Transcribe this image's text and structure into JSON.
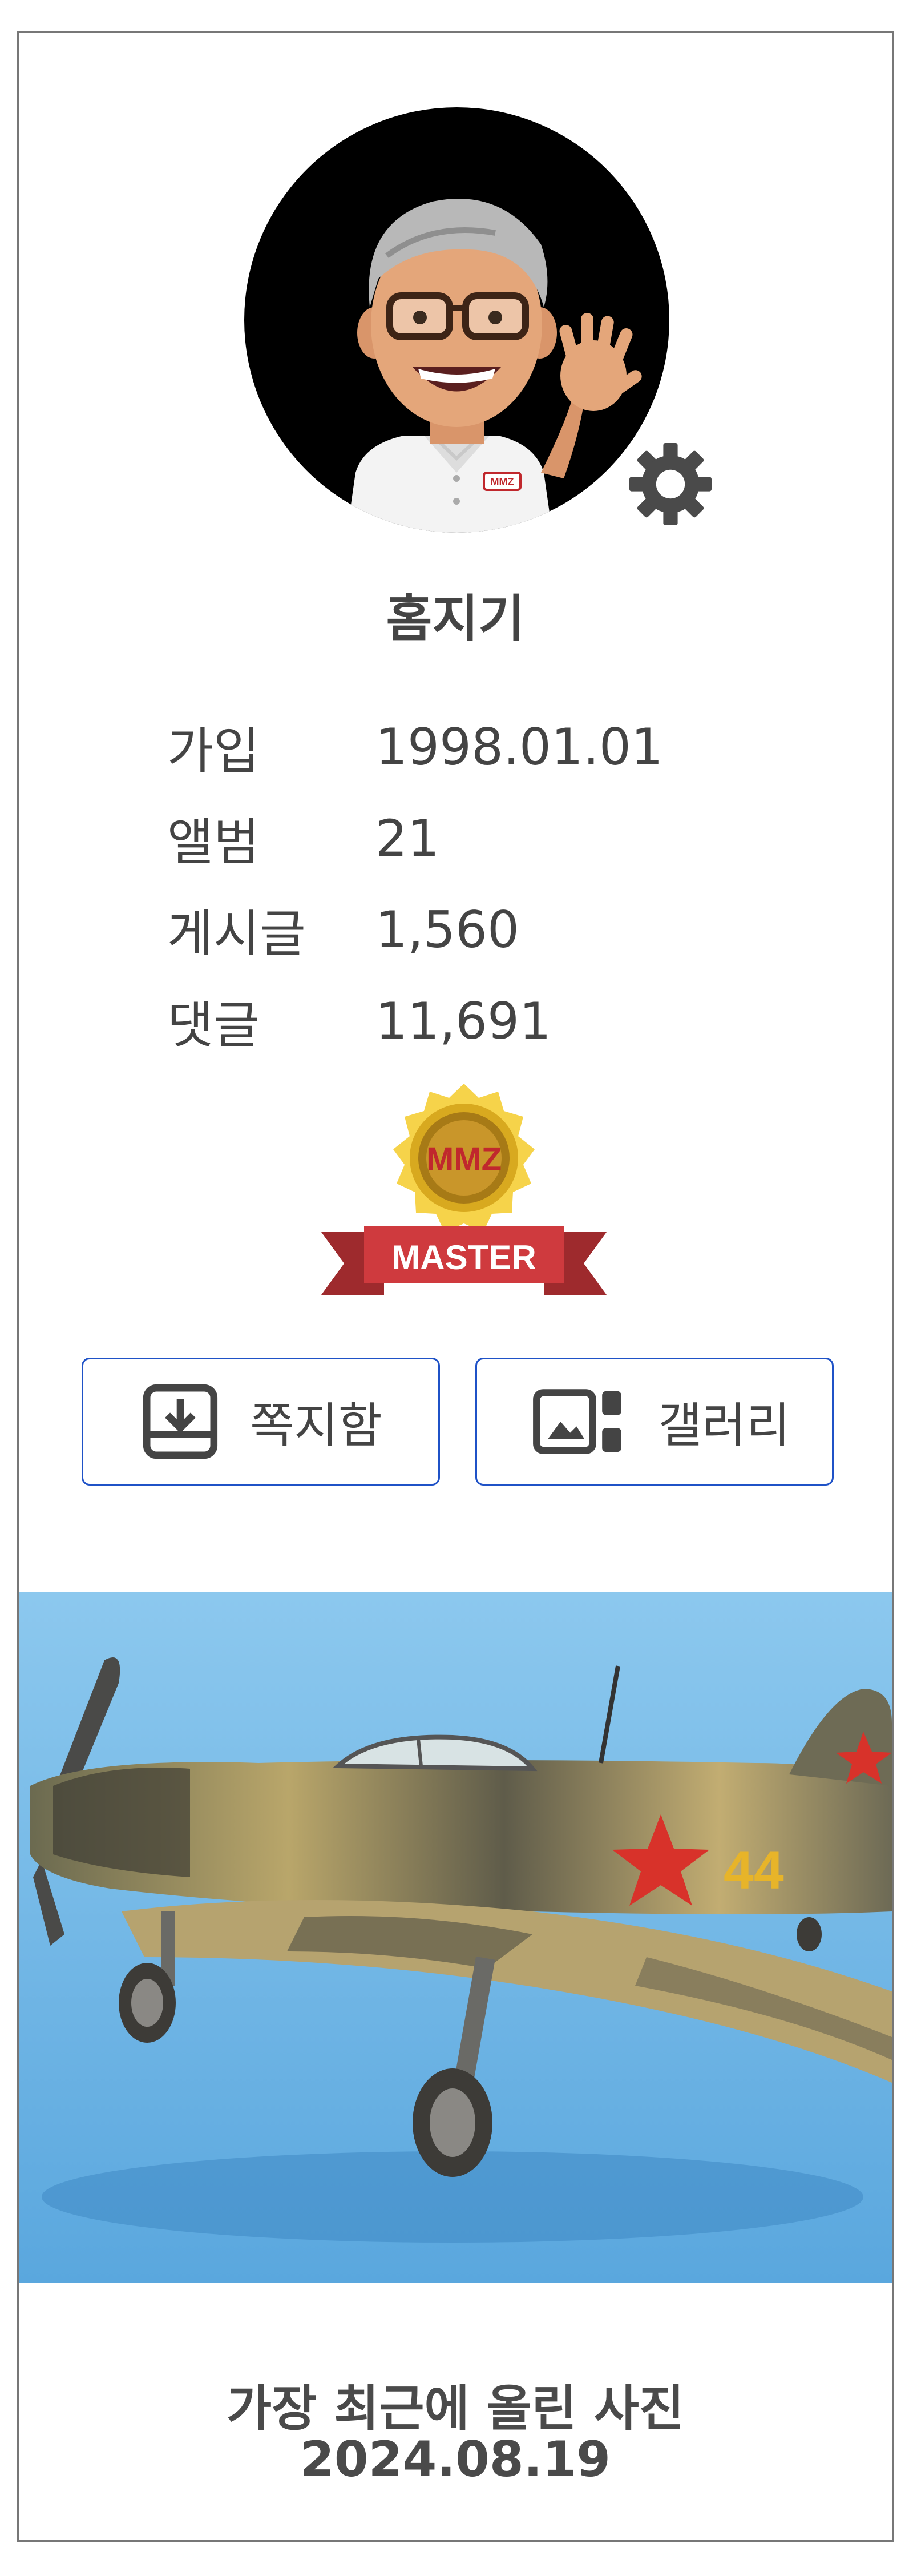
{
  "profile": {
    "name": "홈지기"
  },
  "stats": [
    {
      "label": "가입",
      "value": "1998.01.01"
    },
    {
      "label": "앨범",
      "value": "21"
    },
    {
      "label": "게시글",
      "value": "1,560"
    },
    {
      "label": "댓글",
      "value": "11,691"
    }
  ],
  "badge": {
    "seal_text": "MMZ",
    "ribbon_text": "MASTER",
    "colors": {
      "gold": "#f2c640",
      "ribbon": "#cf3a3e"
    }
  },
  "buttons": {
    "messages_label": "쪽지함",
    "gallery_label": "갤러리"
  },
  "shirt_logo": "MMZ",
  "recent": {
    "caption": "가장 최근에 올린 사진",
    "date": "2024.08.19",
    "aircraft_number": "44"
  },
  "colors": {
    "button_border": "#1f52c7",
    "text": "#444444",
    "photo_bg": "#7fbfe6"
  },
  "icons": {
    "settings": "gear-icon",
    "messages": "inbox-download-icon",
    "gallery": "gallery-icon"
  }
}
